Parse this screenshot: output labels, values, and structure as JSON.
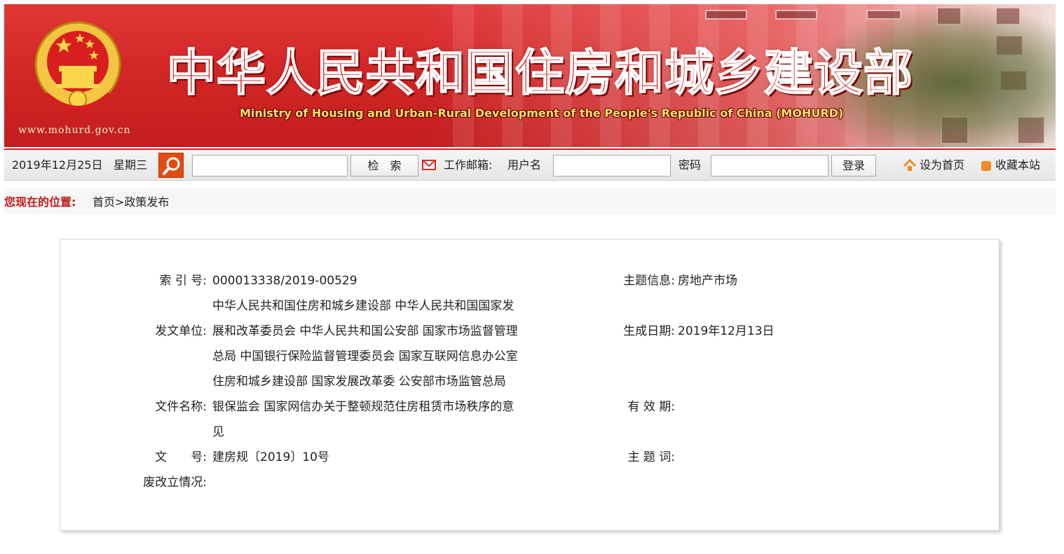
{
  "banner": {
    "url": "www.mohurd.gov.cn",
    "title": "中华人民共和国住房和城乡建设部",
    "subtitle": "Ministry of Housing and Urban-Rural Development of the People's Republic of China (MOHURD)"
  },
  "toolbar": {
    "date": "2019年12月25日",
    "weekday": "星期三",
    "search_value": "",
    "search_button": "检　索",
    "mailbox_label": "工作邮箱:",
    "username_label": "用户名",
    "username_value": "",
    "password_label": "密码",
    "password_value": "",
    "login_button": "登录",
    "set_home": "设为首页",
    "bookmark": "收藏本站",
    "colors": {
      "accent": "#c72020",
      "search_icon_bg": "#e24b12"
    }
  },
  "breadcrumb": {
    "label": "您现在的位置:",
    "home": "首页",
    "separator": ">",
    "current": "政策发布"
  },
  "info": {
    "index_label": "索 引 号:",
    "index_value": "000013338/2019-00529",
    "topic_label": "主题信息:",
    "topic_value": "房地产市场",
    "issuer_label": "发文单位:",
    "issuer_lines": [
      "中华人民共和国住房和城乡建设部 中华人民共和国国家发",
      "展和改革委员会 中华人民共和国公安部 国家市场监督管理",
      "总局 中国银行保险监督管理委员会 国家互联网信息办公室",
      "住房和城乡建设部 国家发展改革委 公安部市场监管总局"
    ],
    "date_label": "生成日期:",
    "date_value": "2019年12月13日",
    "filename_label": "文件名称:",
    "filename_lines": [
      "银保监会 国家网信办关于整顿规范住房租赁市场秩序的意",
      "见"
    ],
    "validity_label": "有 效 期:",
    "validity_value": "",
    "docno_label": "文　　号:",
    "docno_value": "建房规〔2019〕10号",
    "keywords_label": "主 题 词:",
    "keywords_value": "",
    "status_label": "废改立情况:",
    "status_value": ""
  }
}
